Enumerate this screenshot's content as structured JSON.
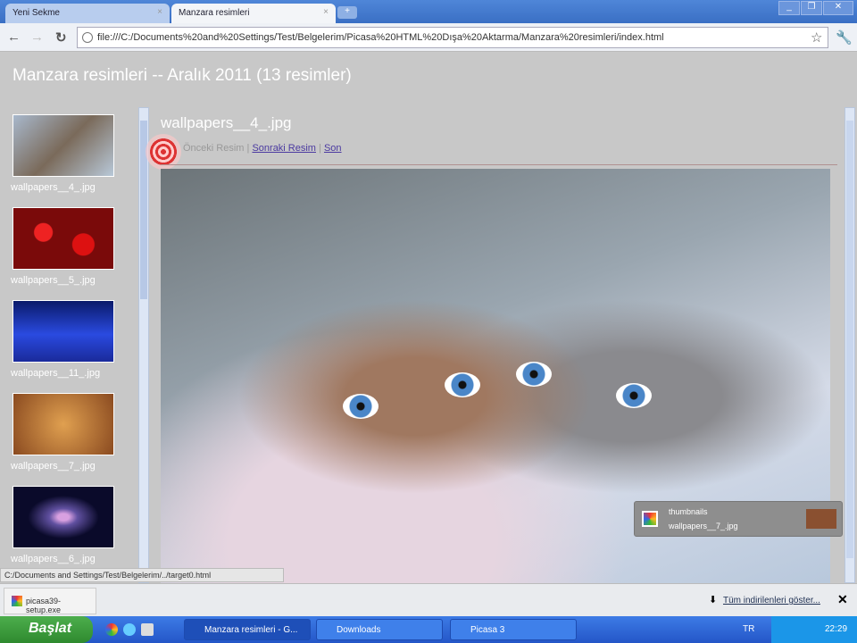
{
  "browser": {
    "tabs": [
      {
        "label": "Yeni Sekme"
      },
      {
        "label": "Manzara resimleri"
      }
    ],
    "url": "file:///C:/Documents%20and%20Settings/Test/Belgelerim/Picasa%20HTML%20Dışa%20Aktarma/Manzara%20resimleri/index.html"
  },
  "page": {
    "title": "Manzara resimleri -- Aralık 2011 (13 resimler)",
    "image_title": "wallpapers__4_.jpg",
    "prev": "Önceki Resim",
    "next": "Sonraki Resim",
    "last": "Son",
    "sep": "|",
    "thumbnails": [
      {
        "label": "wallpapers__4_.jpg"
      },
      {
        "label": "wallpapers__5_.jpg"
      },
      {
        "label": "wallpapers__11_.jpg"
      },
      {
        "label": "wallpapers__7_.jpg"
      },
      {
        "label": "wallpapers__6_.jpg"
      }
    ]
  },
  "status": "C:/Documents and Settings/Test/Belgelerim/../target0.html",
  "notification": {
    "title": "thumbnails",
    "file": "wallpapers__7_.jpg"
  },
  "downloads": {
    "file": "picasa39-setup.exe",
    "show_all": "Tüm indirilenleri göster...",
    "close": "✕"
  },
  "taskbar": {
    "start": "Başlat",
    "tasks": [
      {
        "label": "Manzara resimleri - G..."
      },
      {
        "label": "Downloads"
      },
      {
        "label": "Picasa 3"
      }
    ],
    "lang": "TR",
    "clock": "22:29"
  }
}
